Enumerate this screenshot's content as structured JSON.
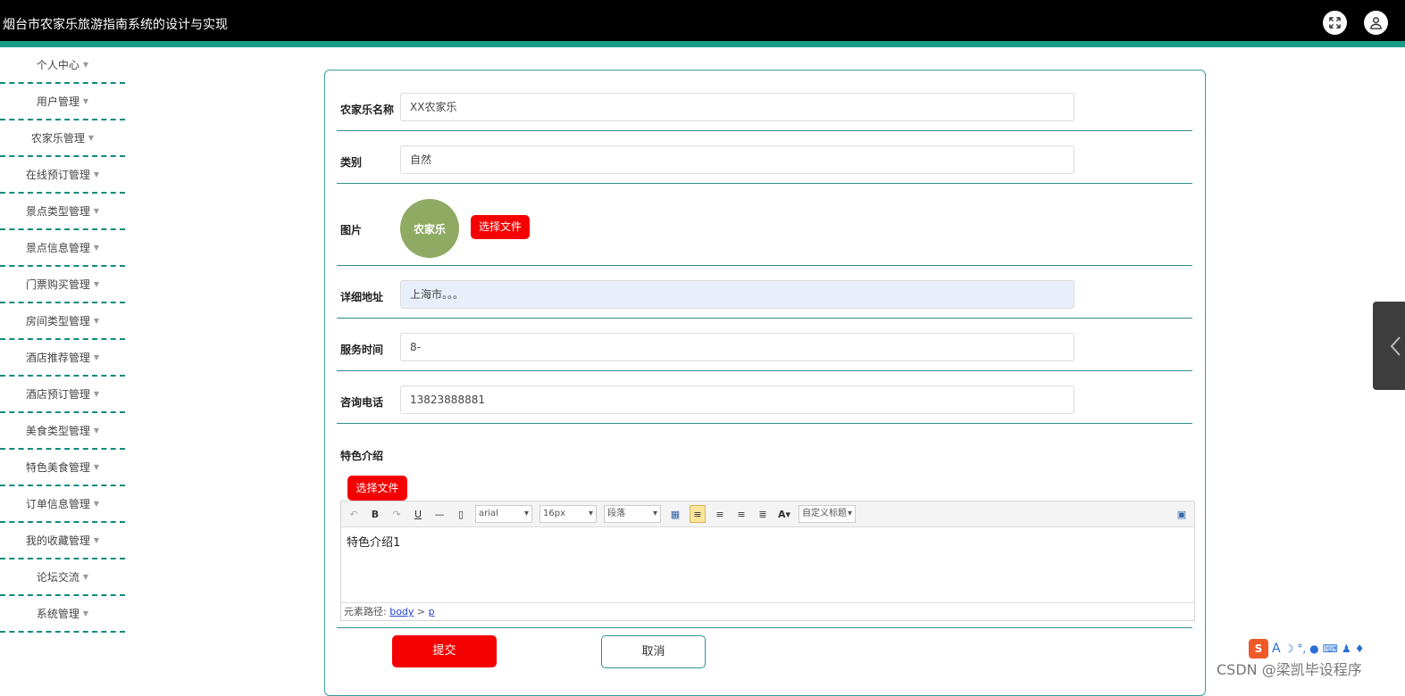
{
  "header": {
    "title": "烟台市农家乐旅游指南系统的设计与实现"
  },
  "sidebar": {
    "items": [
      {
        "label": "个人中心"
      },
      {
        "label": "用户管理"
      },
      {
        "label": "农家乐管理"
      },
      {
        "label": "在线预订管理"
      },
      {
        "label": "景点类型管理"
      },
      {
        "label": "景点信息管理"
      },
      {
        "label": "门票购买管理"
      },
      {
        "label": "房间类型管理"
      },
      {
        "label": "酒店推荐管理"
      },
      {
        "label": "酒店预订管理"
      },
      {
        "label": "美食类型管理"
      },
      {
        "label": "特色美食管理"
      },
      {
        "label": "订单信息管理"
      },
      {
        "label": "我的收藏管理"
      },
      {
        "label": "论坛交流"
      },
      {
        "label": "系统管理"
      }
    ]
  },
  "form": {
    "name": {
      "label": "农家乐名称",
      "value": "XX农家乐"
    },
    "category": {
      "label": "类别",
      "value": "自然"
    },
    "image": {
      "label": "图片",
      "button": "选择文件",
      "logo_text": "农家乐"
    },
    "address": {
      "label": "详细地址",
      "value": "上海市。。。"
    },
    "service_time": {
      "label": "服务时间",
      "value": "8-"
    },
    "phone": {
      "label": "咨询电话",
      "value": "13823888881"
    },
    "intro": {
      "label": "特色介绍",
      "button": "选择文件",
      "editor": {
        "font": "arial",
        "size": "16px",
        "paragraph": "段落",
        "custom_title": "自定义标题",
        "content": "特色介绍1",
        "path_label": "元素路径:",
        "path_body": "body",
        "path_sep": " > ",
        "path_p": "p"
      }
    }
  },
  "actions": {
    "submit": "提交",
    "cancel": "取消"
  },
  "watermark": "CSDN @梁凯毕设程序",
  "colors": {
    "accent": "#1b9b8a",
    "danger": "#f40000",
    "topbar": "#000000"
  }
}
